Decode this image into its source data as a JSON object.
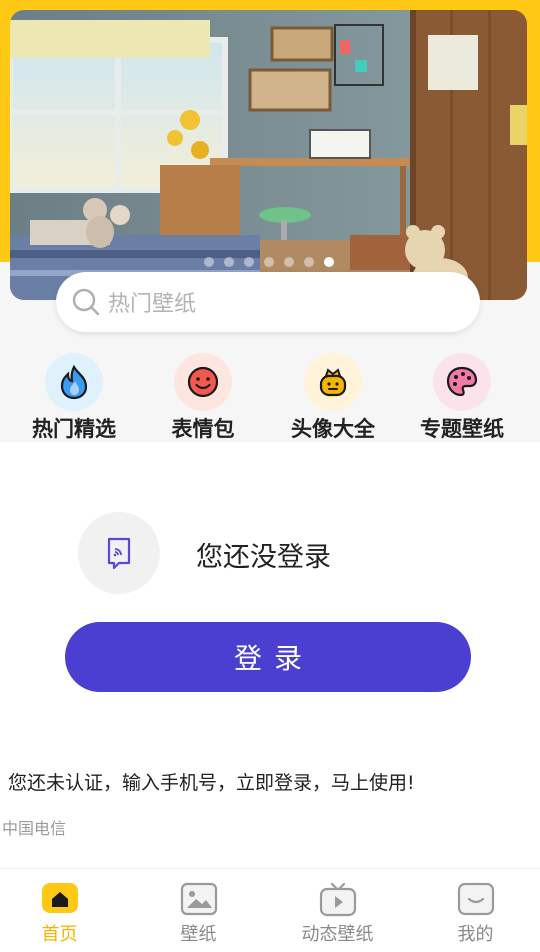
{
  "banner": {
    "page_count": 7,
    "active_index": 6
  },
  "search": {
    "placeholder": "热门壁纸"
  },
  "categories": [
    {
      "label": "热门精选",
      "icon": "flame-icon",
      "bg": "#dff1fb"
    },
    {
      "label": "表情包",
      "icon": "smiley-icon",
      "bg": "#fde6df"
    },
    {
      "label": "头像大全",
      "icon": "avatar-crown-icon",
      "bg": "#fff4d9"
    },
    {
      "label": "专题壁纸",
      "icon": "palette-icon",
      "bg": "#fbe3ec"
    }
  ],
  "login": {
    "title": "您还没登录",
    "button_label": "登录",
    "notice": "您还未认证，输入手机号，立即登录，马上使用!",
    "carrier": "中国电信"
  },
  "bottom_nav": [
    {
      "label": "首页",
      "icon": "home-icon",
      "active": true
    },
    {
      "label": "壁纸",
      "icon": "image-icon",
      "active": false
    },
    {
      "label": "动态壁纸",
      "icon": "video-tv-icon",
      "active": false
    },
    {
      "label": "我的",
      "icon": "profile-icon",
      "active": false
    }
  ],
  "colors": {
    "accent_yellow": "#ffc815",
    "primary_purple": "#4a3fd0",
    "active_tab": "#f5b400"
  }
}
